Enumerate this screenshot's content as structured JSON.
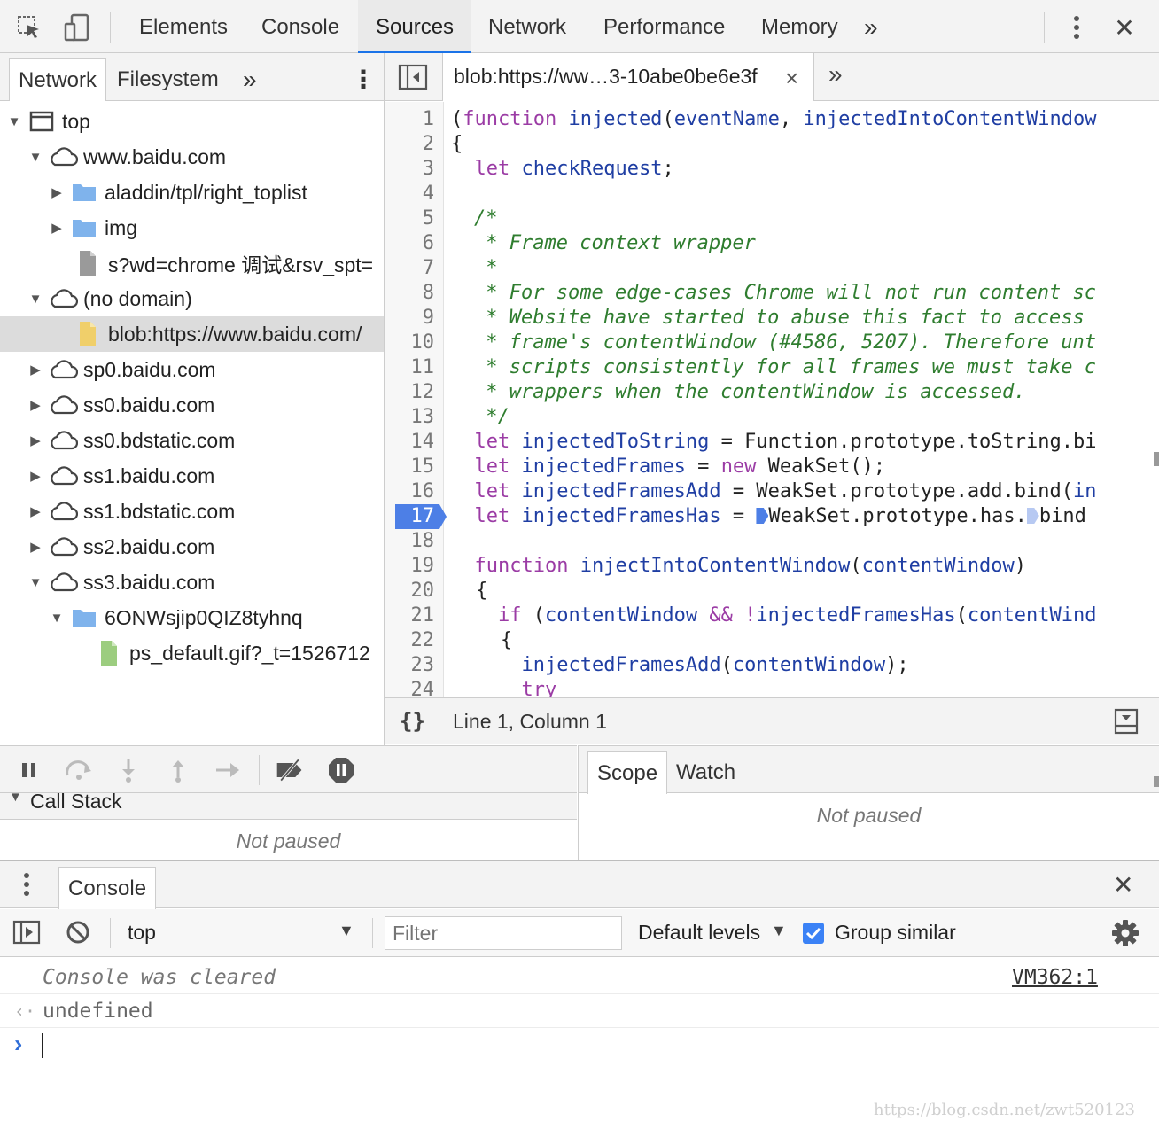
{
  "toolbar": {
    "tabs": [
      "Elements",
      "Console",
      "Sources",
      "Network",
      "Performance",
      "Memory"
    ],
    "active_tab": "Sources",
    "more_label": "»",
    "close_label": "✕"
  },
  "navigator": {
    "tabs": [
      "Network",
      "Filesystem"
    ],
    "more_label": "»",
    "menu_label": "⋮",
    "tree": [
      {
        "label": "top",
        "icon": "frame-icon"
      },
      {
        "label": "www.baidu.com",
        "icon": "cloud-icon"
      },
      {
        "label": "aladdin/tpl/right_toplist",
        "icon": "folder-icon"
      },
      {
        "label": "img",
        "icon": "folder-icon"
      },
      {
        "label": "s?wd=chrome 调试&rsv_spt=",
        "icon": "file-icon"
      },
      {
        "label": "(no domain)",
        "icon": "cloud-icon"
      },
      {
        "label": "blob:https://www.baidu.com/",
        "icon": "script-file-icon"
      },
      {
        "label": "sp0.baidu.com",
        "icon": "cloud-icon"
      },
      {
        "label": "ss0.baidu.com",
        "icon": "cloud-icon"
      },
      {
        "label": "ss0.bdstatic.com",
        "icon": "cloud-icon"
      },
      {
        "label": "ss1.baidu.com",
        "icon": "cloud-icon"
      },
      {
        "label": "ss1.bdstatic.com",
        "icon": "cloud-icon"
      },
      {
        "label": "ss2.baidu.com",
        "icon": "cloud-icon"
      },
      {
        "label": "ss3.baidu.com",
        "icon": "cloud-icon"
      },
      {
        "label": "6ONWsjip0QIZ8tyhnq",
        "icon": "folder-icon"
      },
      {
        "label": "ps_default.gif?_t=1526712",
        "icon": "image-file-icon"
      }
    ]
  },
  "editor": {
    "tab_title": "blob:https://ww…3-10abe0be6e3f",
    "tab_close": "×",
    "more_label": "»",
    "line_numbers": [
      "1",
      "2",
      "3",
      "4",
      "5",
      "6",
      "7",
      "8",
      "9",
      "10",
      "11",
      "12",
      "13",
      "14",
      "15",
      "16",
      "17",
      "18",
      "19",
      "20",
      "21",
      "22",
      "23",
      "24"
    ],
    "breakpoint_line": "17",
    "code": {
      "l1_a": "(",
      "l1_kw": "function",
      "l1_sp": " ",
      "l1_fn": "injected",
      "l1_b": "(",
      "l1_p1": "eventName",
      "l1_c": ", ",
      "l1_p2": "injectedIntoContentWindow",
      "l2": "{",
      "l3_kw": "let",
      "l3_v": "checkRequest",
      "l3_e": ";",
      "l5": "/*",
      "l6": " * Frame context wrapper",
      "l7": " *",
      "l8": " * For some edge-cases Chrome will not run content sc",
      "l9": " * Website have started to abuse this fact to access",
      "l10": " * frame's contentWindow (#4586, 5207). Therefore unt",
      "l11": " * scripts consistently for all frames we must take c",
      "l12": " * wrappers when the contentWindow is accessed.",
      "l13": " */",
      "l14_kw": "let",
      "l14_v": "injectedToString",
      "l14_r": " = Function.prototype.toString.bi",
      "l15_kw": "let",
      "l15_v": "injectedFrames",
      "l15_eq": " = ",
      "l15_new": "new",
      "l15_r": " WeakSet();",
      "l16_kw": "let",
      "l16_v": "injectedFramesAdd",
      "l16_r": " = WeakSet.prototype.add.bind(",
      "l16_v2": "in",
      "l17_kw": "let",
      "l17_v": "injectedFramesHas",
      "l17_eq": " = ",
      "l17_r1": "WeakSet.prototype.has.",
      "l17_r2": "bind",
      "l19_kw": "function",
      "l19_fn": "injectIntoContentWindow",
      "l19_b": "(",
      "l19_p": "contentWindow",
      "l19_e": ")",
      "l20": "{",
      "l21_kw": "if",
      "l21_b": " (",
      "l21_v": "contentWindow",
      "l21_op": " && !",
      "l21_fn": "injectedFramesHas",
      "l21_b2": "(",
      "l21_v2": "contentWind",
      "l22": "{",
      "l23_fn": "injectedFramesAdd",
      "l23_b": "(",
      "l23_v": "contentWindow",
      "l23_e": ");",
      "l24_kw": "try"
    },
    "status": {
      "format_label": "{}",
      "position": "Line 1, Column 1"
    }
  },
  "debugger": {
    "callstack_title": "Call Stack",
    "callstack_status": "Not paused",
    "scope_tabs": [
      "Scope",
      "Watch"
    ],
    "scope_status": "Not paused"
  },
  "console": {
    "drawer_tab": "Console",
    "context": "top",
    "filter_placeholder": "Filter",
    "levels": "Default levels",
    "group_similar": "Group similar",
    "messages": [
      {
        "text": "Console was cleared",
        "source": "VM362:1"
      },
      {
        "text": "undefined"
      }
    ],
    "prompt": "›"
  },
  "watermark": "https://blog.csdn.net/zwt520123",
  "colors": {
    "accent": "#1a73e8",
    "keyword": "#9b3ca5",
    "definition": "#1f3ea3",
    "comment": "#2f7d2f",
    "breakpoint": "#4d7fe6"
  }
}
